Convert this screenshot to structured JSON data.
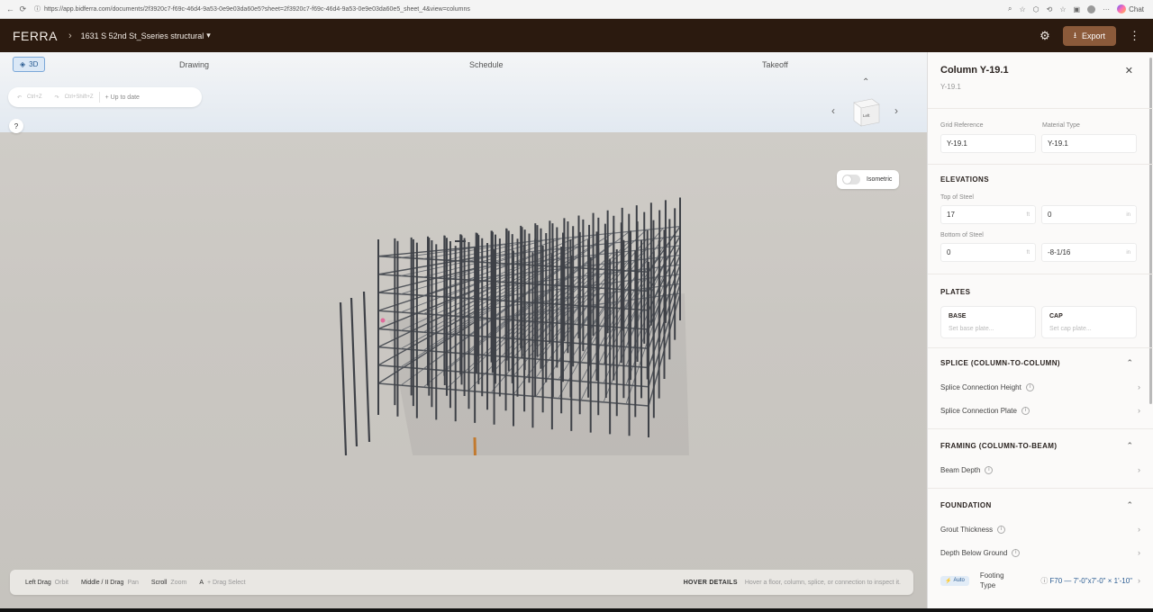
{
  "browser": {
    "url": "https://app.bidferra.com/documents/2f3920c7-f69c-46d4-9a53-0e9e03da60e5?sheet=2f3920c7-f69c-46d4-9a53-0e9e03da60e5_sheet_4&view=columns",
    "chat_label": "Chat"
  },
  "app": {
    "logo": "FERRA",
    "project": "1631 S 52nd St_Sseries structural",
    "export_label": "Export"
  },
  "viewer": {
    "tabs": {
      "three_d": "3D",
      "drawing": "Drawing",
      "schedule": "Schedule",
      "takeoff": "Takeoff"
    },
    "undo": {
      "undo_hint": "Ctrl+Z",
      "redo_hint": "Ctrl+Shift+Z",
      "status": "Up to date"
    },
    "help": "?",
    "viewcube_face": "Left",
    "isometric_label": "Isometric",
    "isometric_on": false,
    "controls": [
      {
        "key": "Left Drag",
        "action": "Orbit"
      },
      {
        "key": "Middle / II Drag",
        "action": "Pan"
      },
      {
        "key": "Scroll",
        "action": "Zoom"
      },
      {
        "key": "A",
        "action": "+ Drag  Select"
      }
    ],
    "hover_title": "HOVER DETAILS",
    "hover_desc": "Hover a floor, column, splice, or connection to inspect it."
  },
  "panel": {
    "title": "Column Y-19.1",
    "subtitle": "Y-19.1",
    "grid_reference_label": "Grid Reference",
    "grid_reference_value": "Y-19.1",
    "material_type_label": "Material Type",
    "material_type_value": "Y-19.1",
    "elevations_heading": "ELEVATIONS",
    "top_of_steel_label": "Top of Steel",
    "top_of_steel_ft": "17",
    "top_of_steel_in": "0",
    "bottom_of_steel_label": "Bottom of Steel",
    "bottom_of_steel_ft": "0",
    "bottom_of_steel_in": "-8-1/16",
    "unit_ft": "ft",
    "unit_in": "in",
    "plates_heading": "PLATES",
    "base_label": "BASE",
    "base_placeholder": "Set base plate...",
    "cap_label": "CAP",
    "cap_placeholder": "Set cap plate...",
    "splice_heading": "SPLICE (COLUMN-TO-COLUMN)",
    "splice_height": "Splice Connection Height",
    "splice_plate": "Splice Connection Plate",
    "framing_heading": "FRAMING (COLUMN-TO-BEAM)",
    "beam_depth": "Beam Depth",
    "foundation_heading": "FOUNDATION",
    "grout_thickness": "Grout Thickness",
    "depth_below_ground": "Depth Below Ground",
    "auto_badge": "Auto",
    "footing_label_1": "Footing",
    "footing_label_2": "Type",
    "footing_value": "F70 — 7'-0\"x7'-0\" × 1'-10\""
  }
}
